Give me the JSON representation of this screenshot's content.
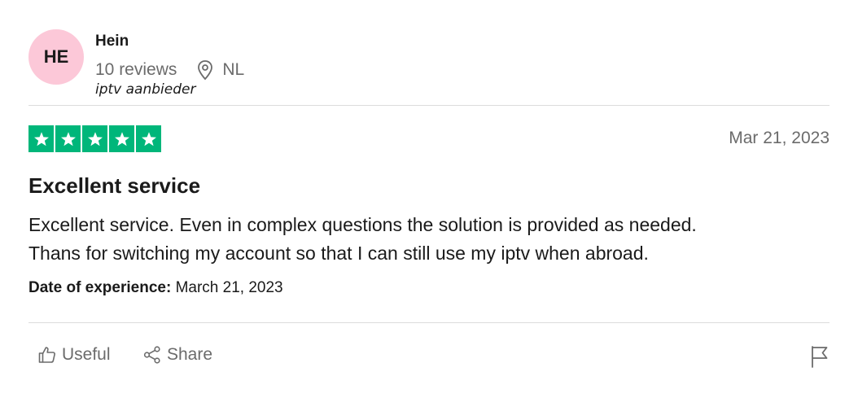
{
  "reviewer": {
    "initials": "HE",
    "name": "Hein",
    "reviews_count": "10 reviews",
    "country": "NL",
    "note": "iptv aanbieder",
    "avatar_color": "#fcc8d8"
  },
  "review": {
    "rating": 5,
    "rating_max": 5,
    "star_color": "#00b67a",
    "date": "Mar 21, 2023",
    "title": "Excellent service",
    "body_line1": "Excellent service. Even in complex questions the solution is provided as needed.",
    "body_line2": "Thans for switching my account so that I can still use my iptv when abroad.",
    "experience_label": "Date of experience:",
    "experience_date": "March 21, 2023"
  },
  "actions": {
    "useful_label": "Useful",
    "share_label": "Share",
    "useful_icon": "thumbs-up-icon",
    "share_icon": "share-icon",
    "report_icon": "flag-icon"
  }
}
